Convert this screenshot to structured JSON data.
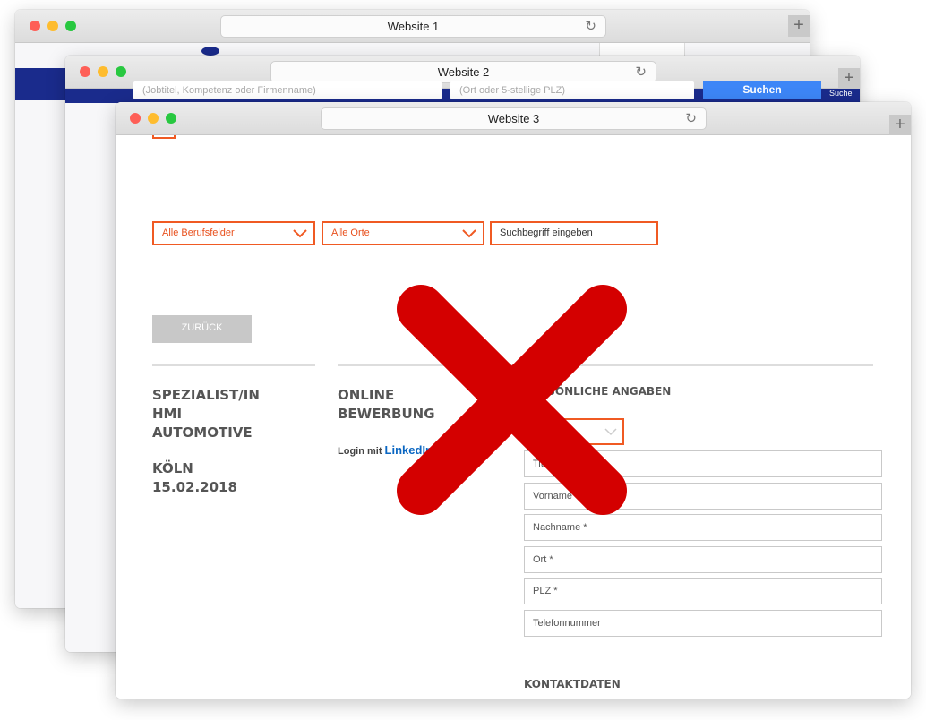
{
  "windows": {
    "w1": {
      "title": "Website 1"
    },
    "w2": {
      "title": "Website 2",
      "search_placeholder_1": "(Jobtitel, Kompetenz oder Firmenname)",
      "search_placeholder_2": "(Ort oder 5-stellige PLZ)",
      "search_button": "Suchen",
      "search_small": "Suche"
    },
    "w3": {
      "title": "Website 3",
      "filters": {
        "field": "Alle Berufsfelder",
        "location": "Alle Orte",
        "search_placeholder": "Suchbegriff eingeben"
      },
      "back_button": "ZURÜCK",
      "job": {
        "title_line1": "SPEZIALIST/IN",
        "title_line2": "HMI",
        "title_line3": "AUTOMOTIVE",
        "city": "KÖLN",
        "date": "15.02.2018"
      },
      "application": {
        "line1": "ONLINE",
        "line2": "BEWERBUNG",
        "login_prefix": "Login mit ",
        "login_brand": "LinkedIn"
      },
      "personal": {
        "heading": "PERSÖNLICHE ANGABEN",
        "fields": [
          "Titel",
          "Vorname *",
          "Nachname *",
          "Ort *",
          "PLZ *",
          "Telefonnummer"
        ]
      },
      "contact_heading": "KONTAKTDATEN"
    }
  },
  "overlay": {
    "icon": "red-x-cross-icon",
    "color": "#d40000"
  },
  "colors": {
    "accent_orange": "#f05a23",
    "brand_blue": "#1a2b8c",
    "button_blue": "#3d86f7",
    "linkedin": "#0a66c2"
  }
}
